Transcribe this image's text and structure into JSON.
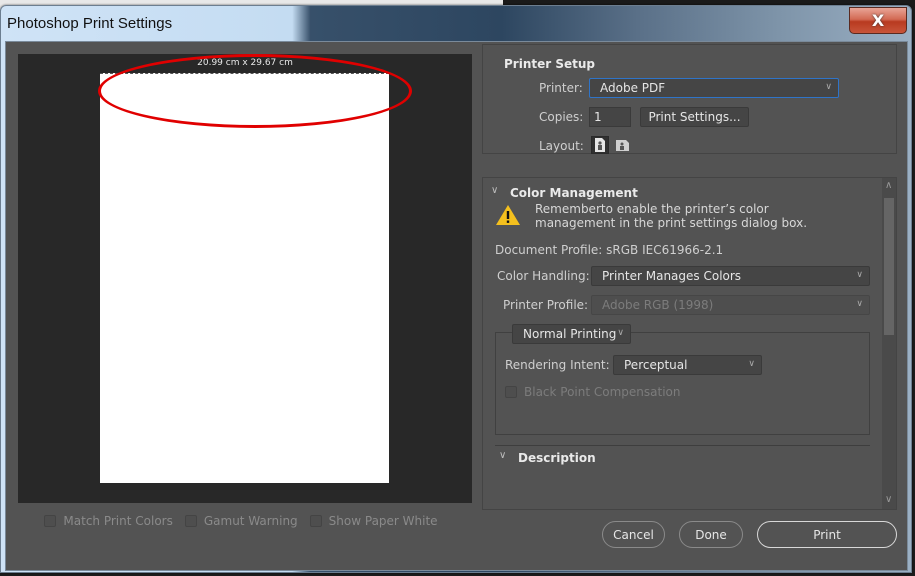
{
  "window": {
    "title": "Photoshop Print Settings",
    "close_icon": "close-icon",
    "close_label": "X"
  },
  "preview": {
    "paper_size": "20.99 cm x 29.67 cm",
    "options": [
      {
        "label": "Match Print Colors",
        "checked": false,
        "enabled": false
      },
      {
        "label": "Gamut Warning",
        "checked": false,
        "enabled": false
      },
      {
        "label": "Show Paper White",
        "checked": false,
        "enabled": false
      }
    ],
    "annotation_color": "#e00000"
  },
  "printer_setup": {
    "title": "Printer Setup",
    "printer_label": "Printer:",
    "printer_value": "Adobe PDF",
    "copies_label": "Copies:",
    "copies_value": "1",
    "print_settings_button": "Print Settings...",
    "layout_label": "Layout:",
    "layout_options": [
      {
        "icon": "portrait-layout-icon",
        "selected": true
      },
      {
        "icon": "landscape-layout-icon",
        "selected": false
      }
    ]
  },
  "color_management": {
    "title": "Color Management",
    "warning_line1": "Rememberto enable the printer’s color",
    "warning_line2": "management in the print settings dialog box.",
    "document_profile": "Document Profile: sRGB IEC61966-2.1",
    "color_handling_label": "Color Handling:",
    "color_handling_value": "Printer Manages Colors",
    "printer_profile_label": "Printer Profile:",
    "printer_profile_value": "Adobe RGB (1998)",
    "printing_mode_value": "Normal Printing",
    "rendering_intent_label": "Rendering Intent:",
    "rendering_intent_value": "Perceptual",
    "black_point_label": "Black Point Compensation",
    "black_point_checked": false
  },
  "description": {
    "title": "Description"
  },
  "buttons": {
    "cancel": "Cancel",
    "done": "Done",
    "print": "Print"
  },
  "colors": {
    "panel_bg": "#535353",
    "preview_bg": "#282828",
    "accent_focus": "#2f74c8",
    "warning": "#f4c01e"
  }
}
